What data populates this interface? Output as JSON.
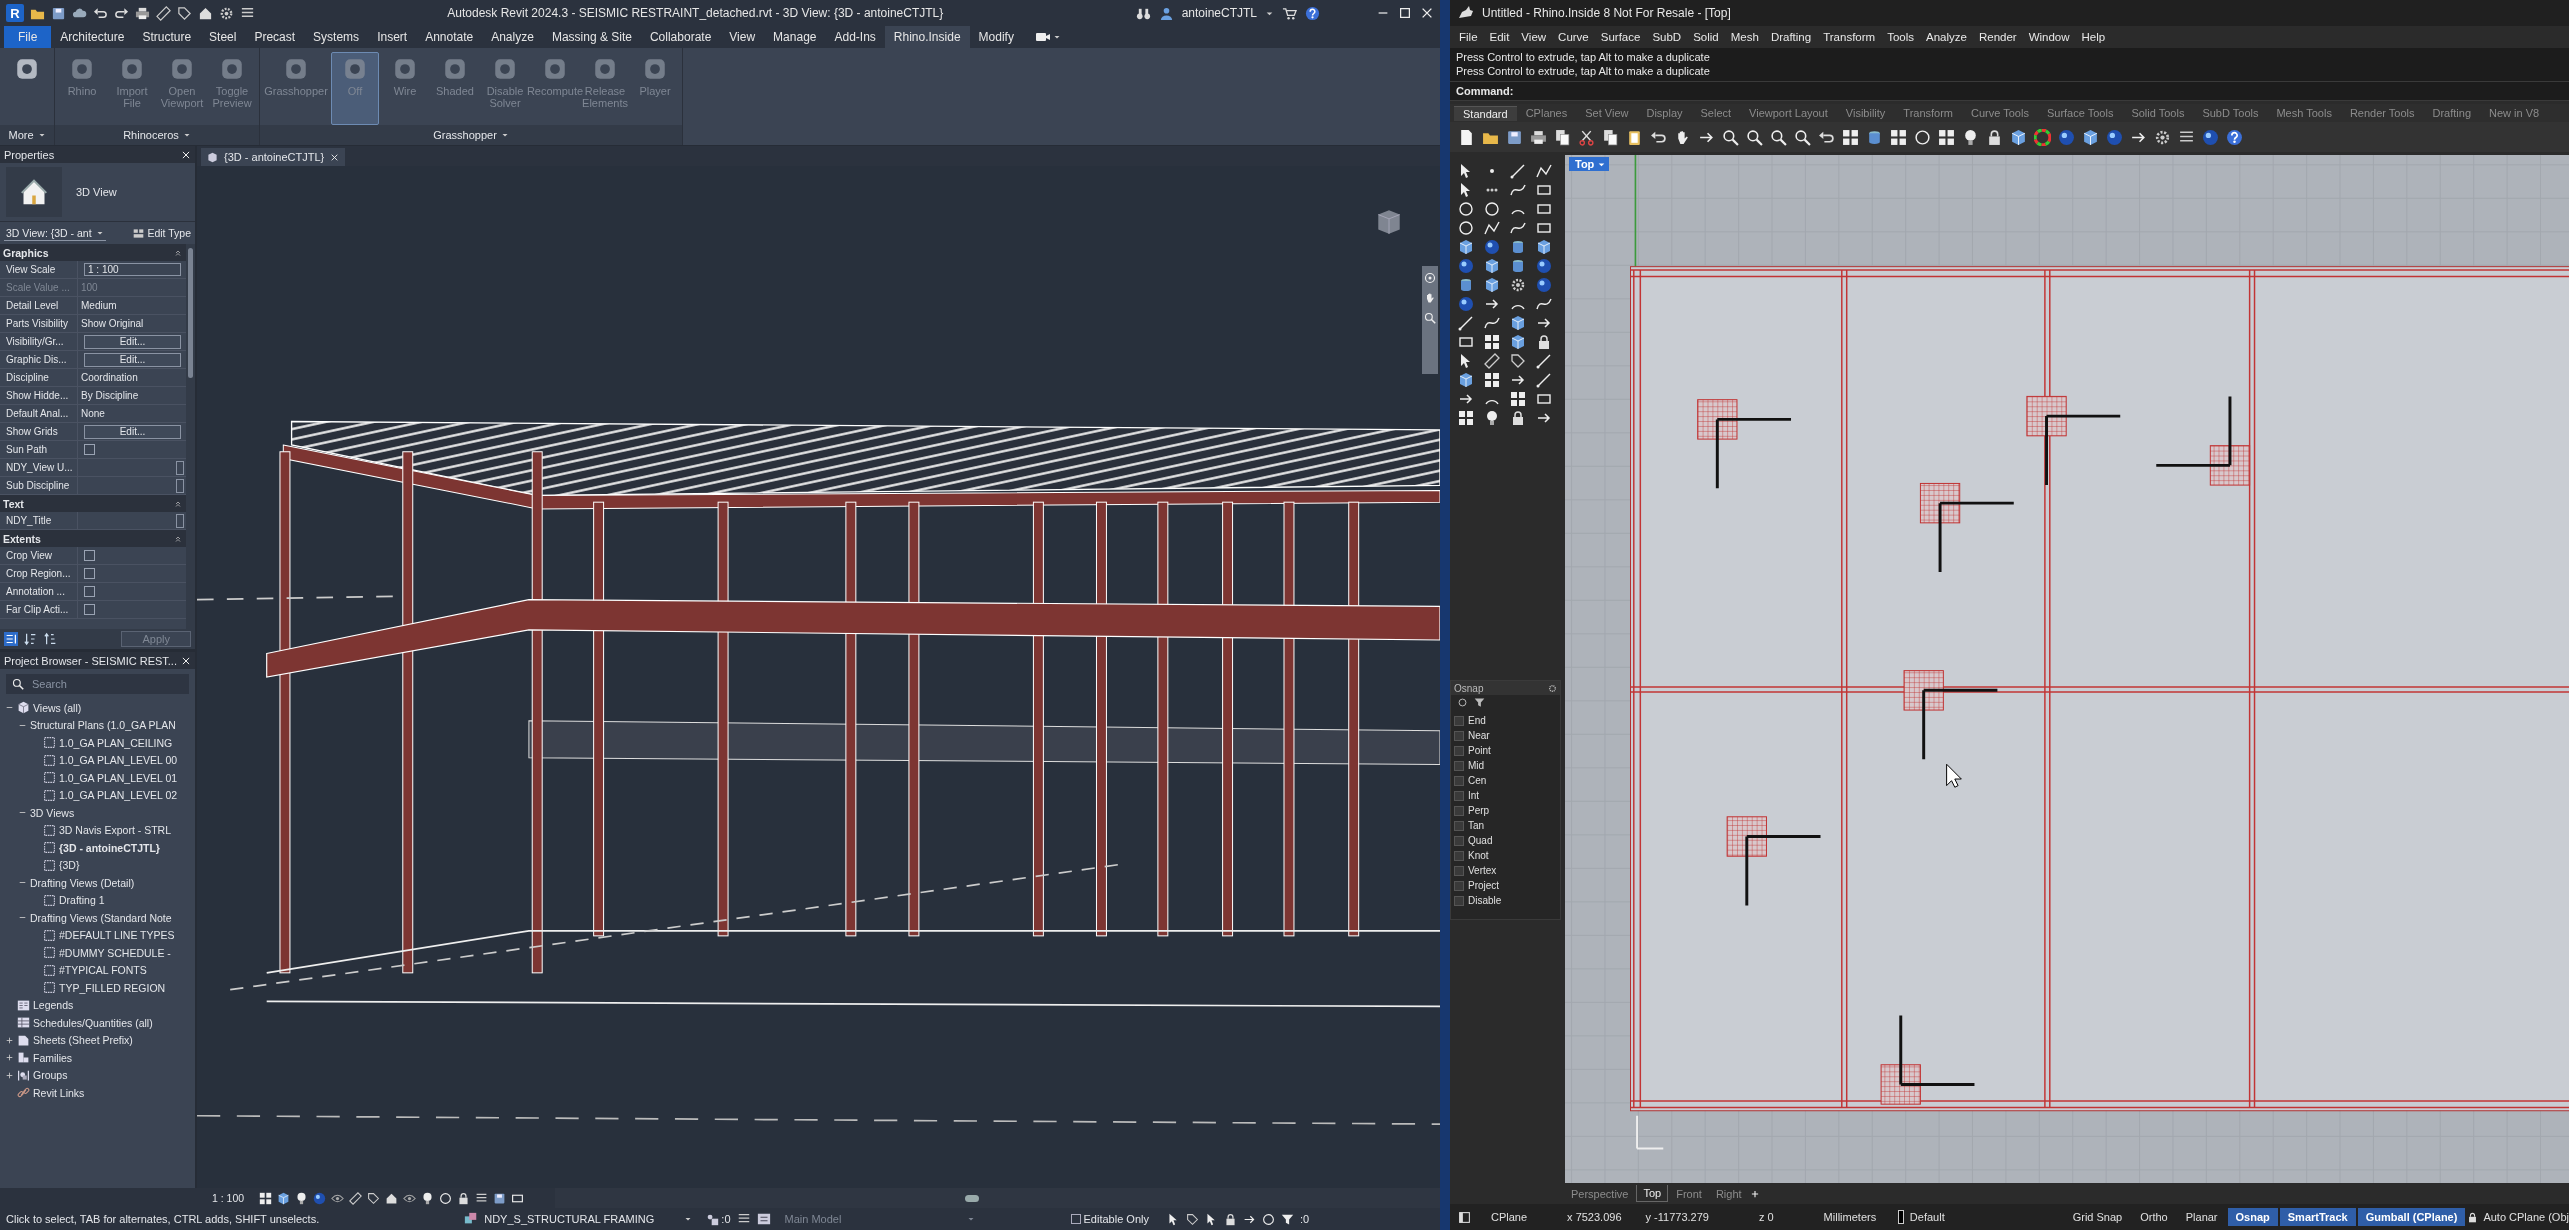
{
  "revit": {
    "logo": "R",
    "title": "Autodesk Revit 2024.3 - SEISMIC RESTRAINT_detached.rvt - 3D View: {3D - antoineCTJTL}",
    "user": "antoineCTJTL",
    "tabs": [
      {
        "label": "File",
        "kind": "file",
        "selected": false
      },
      {
        "label": "Architecture",
        "kind": "tab",
        "selected": false
      },
      {
        "label": "Structure",
        "kind": "tab",
        "selected": false
      },
      {
        "label": "Steel",
        "kind": "tab",
        "selected": false
      },
      {
        "label": "Precast",
        "kind": "tab",
        "selected": false
      },
      {
        "label": "Systems",
        "kind": "tab",
        "selected": false
      },
      {
        "label": "Insert",
        "kind": "tab",
        "selected": false
      },
      {
        "label": "Annotate",
        "kind": "tab",
        "selected": false
      },
      {
        "label": "Analyze",
        "kind": "tab",
        "selected": false
      },
      {
        "label": "Massing & Site",
        "kind": "tab",
        "selected": false
      },
      {
        "label": "Collaborate",
        "kind": "tab",
        "selected": false
      },
      {
        "label": "View",
        "kind": "tab",
        "selected": false
      },
      {
        "label": "Manage",
        "kind": "tab",
        "selected": false
      },
      {
        "label": "Add-Ins",
        "kind": "tab",
        "selected": false
      },
      {
        "label": "Rhino.Inside",
        "kind": "tab",
        "selected": true
      },
      {
        "label": "Modify",
        "kind": "tab",
        "selected": false
      }
    ],
    "ribbon": [
      {
        "title": "More",
        "buttons": [
          {
            "disabled": false,
            "selected": false
          }
        ]
      },
      {
        "title": "Rhinoceros",
        "buttons": [
          {
            "label": "Rhino",
            "disabled": true,
            "selected": false
          },
          {
            "label": "Import File",
            "disabled": true,
            "selected": false
          },
          {
            "label": "Open Viewport",
            "disabled": true,
            "selected": false
          },
          {
            "label": "Toggle Preview",
            "disabled": true,
            "selected": false
          }
        ]
      },
      {
        "title": "Grasshopper",
        "buttons": [
          {
            "label": "Grasshopper",
            "disabled": true,
            "selected": false
          },
          {
            "label": "Off",
            "disabled": true,
            "selected": true
          },
          {
            "label": "Wire",
            "disabled": true,
            "selected": false
          },
          {
            "label": "Shaded",
            "disabled": true,
            "selected": false
          },
          {
            "label": "Disable Solver",
            "disabled": true,
            "selected": false
          },
          {
            "label": "Recompute",
            "disabled": true,
            "selected": false
          },
          {
            "label": "Release Elements",
            "disabled": true,
            "selected": false
          },
          {
            "label": "Player",
            "disabled": true,
            "selected": false
          }
        ]
      }
    ],
    "properties": {
      "title": "Properties",
      "type_name": "3D View",
      "selector": "3D View: {3D - ant",
      "edit_type": "Edit Type",
      "sections": [
        {
          "title": "Graphics",
          "rows": [
            {
              "name": "View Scale",
              "value": "1 : 100",
              "kind": "field"
            },
            {
              "name": "Scale Value ...",
              "value": "100",
              "kind": "readonly"
            },
            {
              "name": "Detail Level",
              "value": "Medium",
              "kind": "text"
            },
            {
              "name": "Parts Visibility",
              "value": "Show Original",
              "kind": "text"
            },
            {
              "name": "Visibility/Gr...",
              "value": "Edit...",
              "kind": "button"
            },
            {
              "name": "Graphic Dis...",
              "value": "Edit...",
              "kind": "button"
            },
            {
              "name": "Discipline",
              "value": "Coordination",
              "kind": "text"
            },
            {
              "name": "Show Hidde...",
              "value": "By Discipline",
              "kind": "text"
            },
            {
              "name": "Default Anal...",
              "value": "None",
              "kind": "text"
            },
            {
              "name": "Show Grids",
              "value": "Edit...",
              "kind": "button"
            },
            {
              "name": "Sun Path",
              "kind": "check",
              "checked": false
            },
            {
              "name": "NDY_View U...",
              "kind": "param"
            },
            {
              "name": "Sub Discipline",
              "kind": "param"
            }
          ]
        },
        {
          "title": "Text",
          "rows": [
            {
              "name": "NDY_Title",
              "kind": "param"
            }
          ]
        },
        {
          "title": "Extents",
          "rows": [
            {
              "name": "Crop View",
              "kind": "check",
              "checked": false
            },
            {
              "name": "Crop Region...",
              "kind": "check",
              "checked": false
            },
            {
              "name": "Annotation ...",
              "kind": "check",
              "checked": false
            },
            {
              "name": "Far Clip Acti...",
              "kind": "check",
              "checked": false
            }
          ]
        }
      ],
      "apply": {
        "label": "Apply",
        "disabled": true
      }
    },
    "browser": {
      "title": "Project Browser - SEISMIC REST...",
      "search_placeholder": "Search",
      "tree": [
        {
          "label": "Views (all)",
          "kind": "views",
          "expanded": true,
          "children": [
            {
              "label": "Structural Plans (1.0_GA PLAN",
              "expanded": true,
              "children": [
                {
                  "label": "1.0_GA PLAN_CEILING",
                  "kind": "view",
                  "open": false
                },
                {
                  "label": "1.0_GA PLAN_LEVEL 00",
                  "kind": "view",
                  "open": false
                },
                {
                  "label": "1.0_GA PLAN_LEVEL 01",
                  "kind": "view",
                  "open": false
                },
                {
                  "label": "1.0_GA PLAN_LEVEL 02",
                  "kind": "view",
                  "open": false
                }
              ]
            },
            {
              "label": "3D Views",
              "expanded": true,
              "children": [
                {
                  "label": "3D Navis Export - STRL",
                  "kind": "view",
                  "open": false
                },
                {
                  "label": "{3D - antoineCTJTL}",
                  "kind": "view",
                  "open": true
                },
                {
                  "label": "{3D}",
                  "kind": "view",
                  "open": false
                }
              ]
            },
            {
              "label": "Drafting Views (Detail)",
              "expanded": true,
              "children": [
                {
                  "label": "Drafting 1",
                  "kind": "view",
                  "open": false
                }
              ]
            },
            {
              "label": "Drafting Views (Standard Note",
              "expanded": true,
              "children": [
                {
                  "label": "#DEFAULT LINE TYPES",
                  "kind": "view",
                  "open": false
                },
                {
                  "label": "#DUMMY SCHEDULE -",
                  "kind": "view",
                  "open": false
                },
                {
                  "label": "#TYPICAL FONTS",
                  "kind": "view",
                  "open": false
                },
                {
                  "label": "TYP_FILLED REGION",
                  "kind": "view",
                  "open": false
                }
              ]
            }
          ]
        },
        {
          "label": "Legends",
          "kind": "legends"
        },
        {
          "label": "Schedules/Quantities (all)",
          "kind": "schedules"
        },
        {
          "label": "Sheets (Sheet Prefix)",
          "kind": "sheets",
          "expanded": false
        },
        {
          "label": "Families",
          "kind": "families",
          "expanded": false
        },
        {
          "label": "Groups",
          "kind": "groups",
          "expanded": false
        },
        {
          "label": "Revit Links",
          "kind": "links"
        }
      ]
    },
    "viewport": {
      "tab": "{3D - antoineCTJTL}"
    },
    "view_bar": {
      "scale": "1 : 100"
    },
    "status": {
      "hint": "Click to select, TAB for alternates, CTRL adds, SHIFT unselects.",
      "workset": "NDY_S_STRUCTURAL FRAMING",
      "workset_count": ":0",
      "design_option": "Main Model",
      "editable_only": {
        "label": "Editable Only",
        "checked": false
      },
      "filter_count": ":0"
    }
  },
  "rhino": {
    "title": "Untitled - Rhino.Inside 8 Not For Resale - [Top]",
    "menu": [
      "File",
      "Edit",
      "View",
      "Curve",
      "Surface",
      "SubD",
      "Solid",
      "Mesh",
      "Drafting",
      "Transform",
      "Tools",
      "Analyze",
      "Render",
      "Window",
      "Help"
    ],
    "history": [
      "Press Control to extrude, tap Alt to make a duplicate",
      "Press Control to extrude, tap Alt to make a duplicate"
    ],
    "command_label": "Command:",
    "toolbar_tabs": [
      {
        "label": "Standard",
        "selected": true
      },
      {
        "label": "CPlanes",
        "selected": false
      },
      {
        "label": "Set View",
        "selected": false
      },
      {
        "label": "Display",
        "selected": false
      },
      {
        "label": "Select",
        "selected": false
      },
      {
        "label": "Viewport Layout",
        "selected": false
      },
      {
        "label": "Visibility",
        "selected": false
      },
      {
        "label": "Transform",
        "selected": false
      },
      {
        "label": "Curve Tools",
        "selected": false
      },
      {
        "label": "Surface Tools",
        "selected": false
      },
      {
        "label": "Solid Tools",
        "selected": false
      },
      {
        "label": "SubD Tools",
        "selected": false
      },
      {
        "label": "Mesh Tools",
        "selected": false
      },
      {
        "label": "Render Tools",
        "selected": false
      },
      {
        "label": "Drafting",
        "selected": false
      },
      {
        "label": "New in V8",
        "selected": false
      }
    ],
    "viewport": {
      "label": "Top"
    },
    "osnap": {
      "title": "Osnap",
      "items": [
        {
          "label": "End",
          "checked": false
        },
        {
          "label": "Near",
          "checked": false
        },
        {
          "label": "Point",
          "checked": false
        },
        {
          "label": "Mid",
          "checked": false
        },
        {
          "label": "Cen",
          "checked": false
        },
        {
          "label": "Int",
          "checked": false
        },
        {
          "label": "Perp",
          "checked": false
        },
        {
          "label": "Tan",
          "checked": false
        },
        {
          "label": "Quad",
          "checked": false
        },
        {
          "label": "Knot",
          "checked": false
        },
        {
          "label": "Vertex",
          "checked": false
        },
        {
          "label": "Project",
          "checked": false
        },
        {
          "label": "Disable",
          "checked": false
        }
      ]
    },
    "viewport_tabs": [
      {
        "label": "Perspective",
        "selected": false
      },
      {
        "label": "Top",
        "selected": true
      },
      {
        "label": "Front",
        "selected": false
      },
      {
        "label": "Right",
        "selected": false
      }
    ],
    "status": {
      "cplane": "CPlane",
      "x": "x 7523.096",
      "y": "y -11773.279",
      "z": "z 0",
      "units": "Millimeters",
      "layer": {
        "name": "Default",
        "color": "#000000"
      },
      "toggles": [
        {
          "label": "Grid Snap",
          "on": false
        },
        {
          "label": "Ortho",
          "on": false
        },
        {
          "label": "Planar",
          "on": false
        },
        {
          "label": "Osnap",
          "on": true
        },
        {
          "label": "SmartTrack",
          "on": true
        },
        {
          "label": "Gumball (CPlane)",
          "on": true
        }
      ],
      "auto_cplane": "Auto CPlane (Obj"
    }
  }
}
